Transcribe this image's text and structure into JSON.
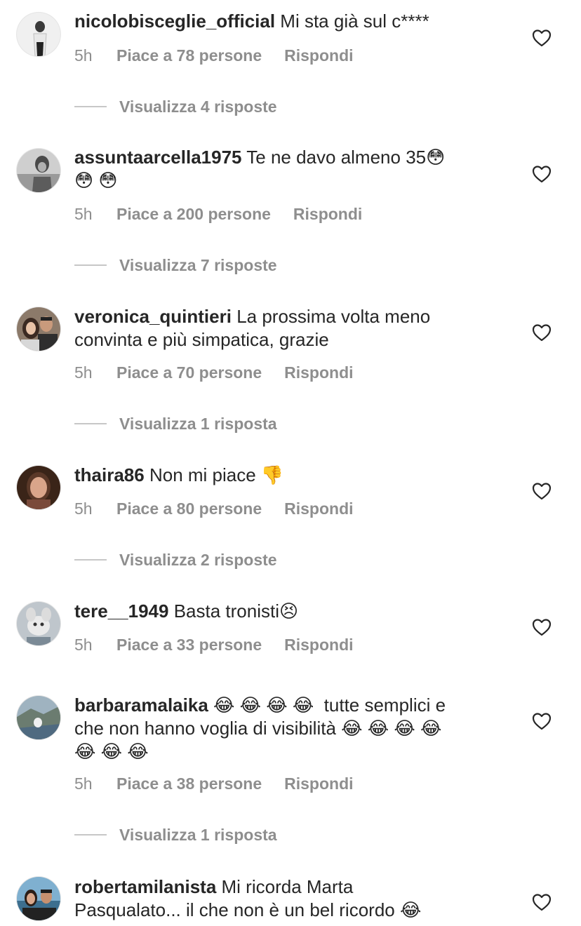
{
  "comments": [
    {
      "username": "nicolobisceglie_official",
      "text": " Mi sta già sul c****",
      "time": "5h",
      "likes": "Piace a 78 persone",
      "reply": "Rispondi",
      "view_replies": "Visualizza 4 risposte"
    },
    {
      "username": "assuntaarcella1975",
      "text": " Te ne davo almeno 35😳\n😳 😳",
      "time": "5h",
      "likes": "Piace a 200 persone",
      "reply": "Rispondi",
      "view_replies": "Visualizza 7 risposte"
    },
    {
      "username": "veronica_quintieri",
      "text": " La prossima volta meno\nconvinta e più simpatica, grazie",
      "time": "5h",
      "likes": "Piace a 70 persone",
      "reply": "Rispondi",
      "view_replies": "Visualizza 1 risposta"
    },
    {
      "username": "thaira86",
      "text": " Non mi piace 👎",
      "time": "5h",
      "likes": "Piace a 80 persone",
      "reply": "Rispondi",
      "view_replies": "Visualizza 2 risposte"
    },
    {
      "username": "tere__1949",
      "text": " Basta tronisti😣",
      "time": "5h",
      "likes": "Piace a 33 persone",
      "reply": "Rispondi"
    },
    {
      "username": "barbaramalaika",
      "text": " 😂 😂 😂 😂  tutte semplici e\nche non hanno voglia di visibilità 😂 😂 😂 😂\n😂 😂 😂",
      "time": "5h",
      "likes": "Piace a 38 persone",
      "reply": "Rispondi",
      "view_replies": "Visualizza 1 risposta"
    },
    {
      "username": "robertamilanista",
      "text": " Mi ricorda Marta\nPasqualato... il che non è un bel ricordo 😂"
    }
  ],
  "icons": {
    "like": "heart-outline-icon"
  },
  "colors": {
    "text": "#262626",
    "muted": "#8e8e8e",
    "divider": "#c7c7c7"
  }
}
